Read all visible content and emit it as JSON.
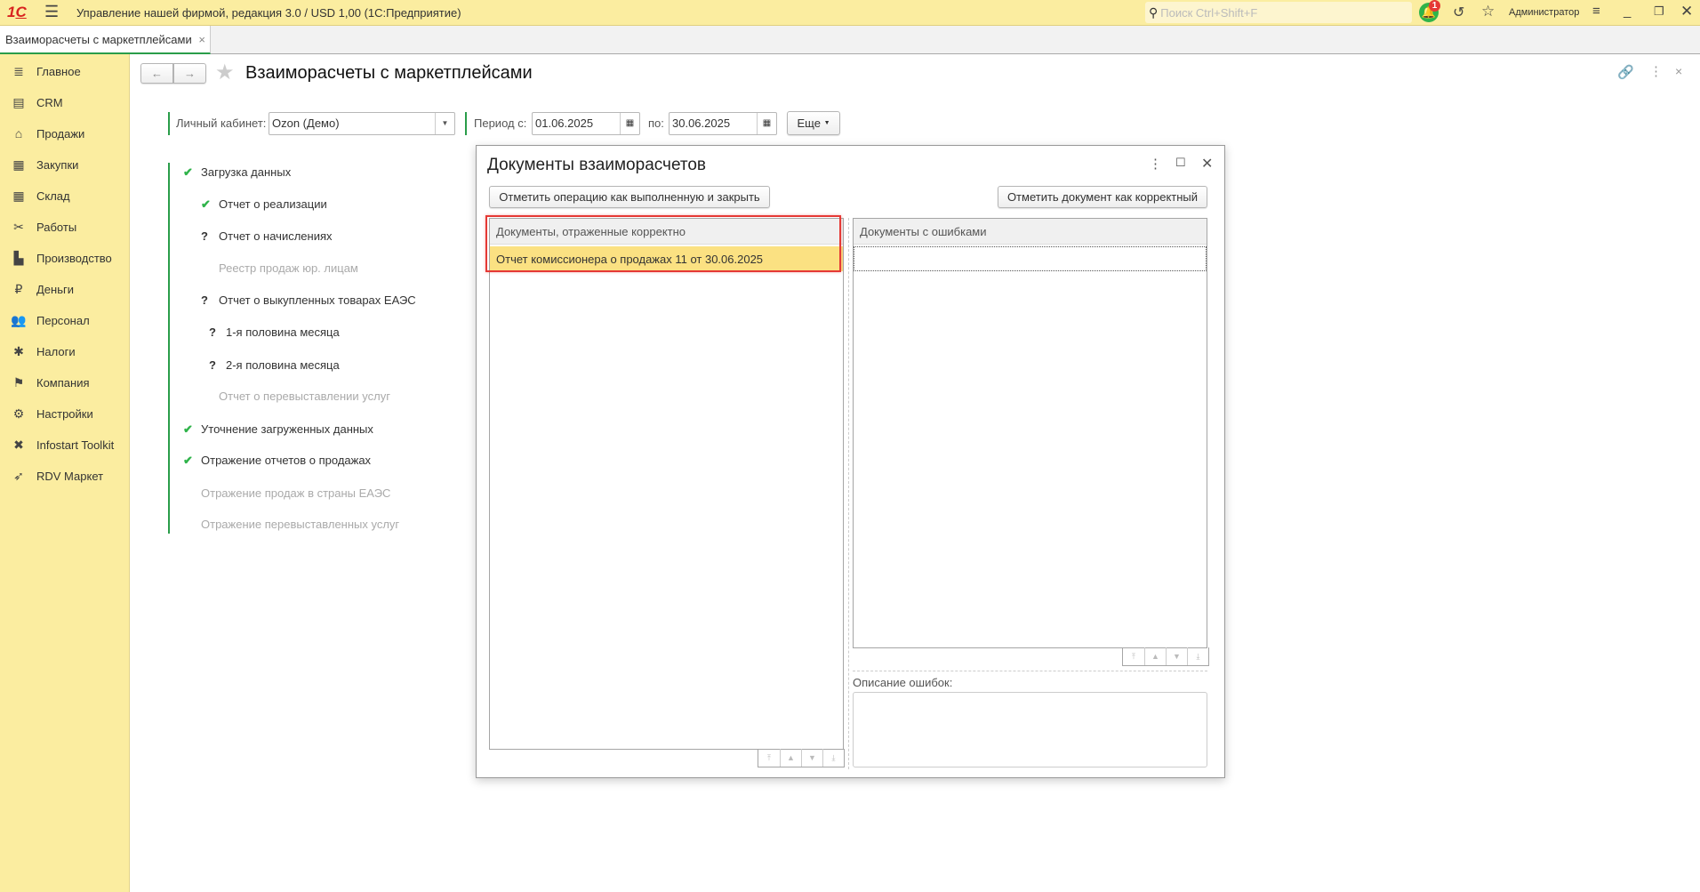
{
  "app": {
    "title": "Управление нашей фирмой, редакция 3.0 / USD 1,00  (1С:Предприятие)",
    "search_placeholder": "Поиск Ctrl+Shift+F",
    "notification_count": "1",
    "user": "Администратор",
    "logo": "1С"
  },
  "tab": {
    "label": "Взаиморасчеты с маркетплейсами"
  },
  "sidebar": {
    "items": [
      {
        "label": "Главное",
        "icon": "≣"
      },
      {
        "label": "CRM",
        "icon": "▤"
      },
      {
        "label": "Продажи",
        "icon": "⌂"
      },
      {
        "label": "Закупки",
        "icon": "▦"
      },
      {
        "label": "Склад",
        "icon": "▦"
      },
      {
        "label": "Работы",
        "icon": "✂"
      },
      {
        "label": "Производство",
        "icon": "▙"
      },
      {
        "label": "Деньги",
        "icon": "₽"
      },
      {
        "label": "Персонал",
        "icon": "👥"
      },
      {
        "label": "Налоги",
        "icon": "✱"
      },
      {
        "label": "Компания",
        "icon": "⚑"
      },
      {
        "label": "Настройки",
        "icon": "⚙"
      },
      {
        "label": "Infostart Toolkit",
        "icon": "✖"
      },
      {
        "label": "RDV Маркет",
        "icon": "➶"
      }
    ]
  },
  "page": {
    "title": "Взаиморасчеты с маркетплейсами",
    "filters": {
      "account_label": "Личный кабинет:",
      "account_value": "Ozon (Демо)",
      "period_from_label": "Период с:",
      "period_from": "01.06.2025",
      "period_to_label": "по:",
      "period_to": "30.06.2025",
      "more_label": "Еще"
    },
    "steps": [
      {
        "label": "Загрузка данных",
        "status": "done",
        "level": 0
      },
      {
        "label": "Отчет о реализации",
        "status": "done",
        "level": 1
      },
      {
        "label": "Отчет о начислениях",
        "status": "question",
        "level": 1
      },
      {
        "label": "Реестр продаж юр. лицам",
        "status": "disabled",
        "level": 1
      },
      {
        "label": "Отчет о выкупленных товарах ЕАЭС",
        "status": "question",
        "level": 1
      },
      {
        "label": "1-я половина месяца",
        "status": "question",
        "level": 2
      },
      {
        "label": "2-я половина месяца",
        "status": "question",
        "level": 2
      },
      {
        "label": "Отчет о перевыставлении услуг",
        "status": "disabled",
        "level": 1
      },
      {
        "label": "Уточнение загруженных данных",
        "status": "done",
        "level": 0
      },
      {
        "label": "Отражение отчетов о продажах",
        "status": "done",
        "level": 0
      },
      {
        "label": "Отражение продаж в страны ЕАЭС",
        "status": "disabled",
        "level": 0
      },
      {
        "label": "Отражение перевыставленных услуг",
        "status": "disabled",
        "level": 0
      }
    ]
  },
  "dialog": {
    "title": "Документы взаиморасчетов",
    "mark_done_button": "Отметить операцию как выполненную и закрыть",
    "mark_correct_button": "Отметить документ как корректный",
    "correct_table": {
      "header": "Документы, отраженные корректно",
      "rows": [
        "Отчет комиссионера о продажах 11 от 30.06.2025"
      ]
    },
    "errors_table": {
      "header": "Документы с ошибками",
      "rows": []
    },
    "error_description_label": "Описание ошибок:",
    "error_description_value": ""
  },
  "colors": {
    "accent_green": "#2a9d4a",
    "sidebar_bg": "#fbeda0",
    "selected_row": "#fbe182",
    "highlight_frame": "#e53935"
  }
}
